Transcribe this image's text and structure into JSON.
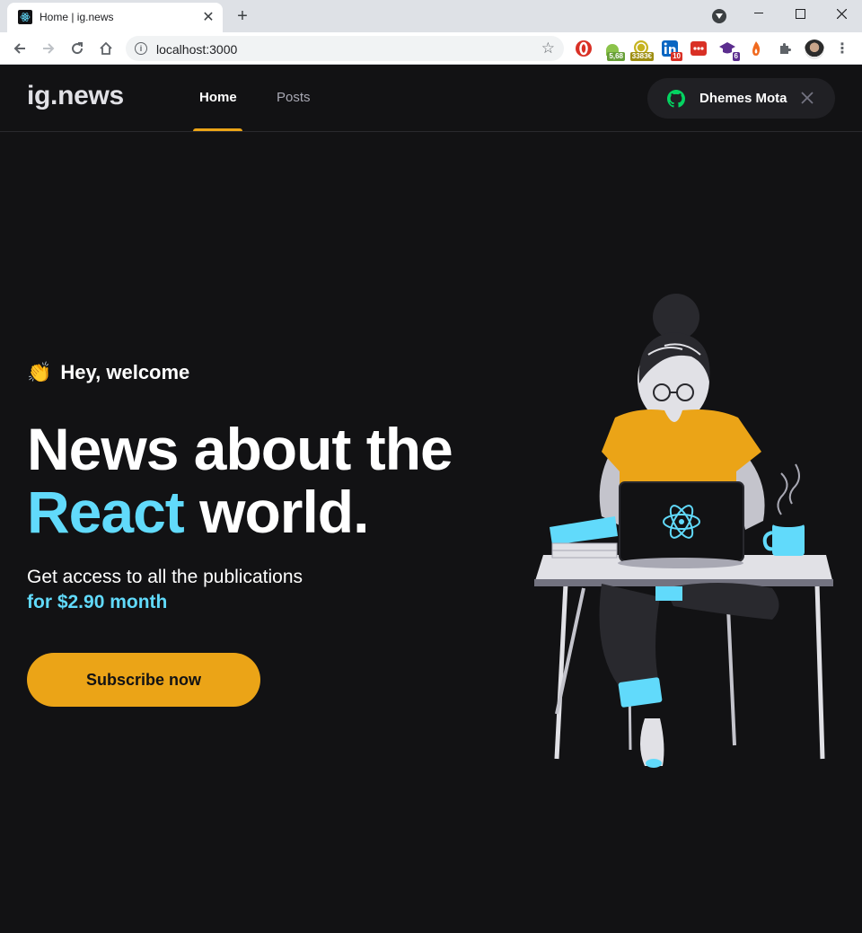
{
  "browser": {
    "tab_title": "Home | ig.news",
    "url": "localhost:3000",
    "extensions": [
      {
        "name": "opera-adblock-icon",
        "color": "#d93025",
        "badge": ""
      },
      {
        "name": "android-ext-icon",
        "color": "#8bc34a",
        "badge": "5,68"
      },
      {
        "name": "coin-ext-icon",
        "color": "#c6b31f",
        "badge": "3383€"
      },
      {
        "name": "linkedin-ext-icon",
        "color": "#0a66c2",
        "badge": "10"
      },
      {
        "name": "red-dots-ext-icon",
        "color": "#d93025",
        "badge": ""
      },
      {
        "name": "graduation-ext-icon",
        "color": "#5b2d8e",
        "badge": "6"
      },
      {
        "name": "flame-ext-icon",
        "color": "#f06a1f",
        "badge": ""
      }
    ]
  },
  "header": {
    "logo": "ig.news",
    "nav": [
      {
        "label": "Home",
        "active": true
      },
      {
        "label": "Posts",
        "active": false
      }
    ],
    "signin": {
      "name": "Dhemes Mota"
    }
  },
  "hero": {
    "greeting": "Hey, welcome",
    "greeting_emoji": "👏",
    "title_line1": "News about the",
    "title_accent": "React",
    "title_line2_rest": "world.",
    "subtitle": "Get access to all the publications",
    "price": "for $2.90 month",
    "cta": "Subscribe now"
  },
  "colors": {
    "background": "#121214",
    "accent_yellow": "#eba417",
    "accent_cyan": "#61dafb",
    "surface": "#202024"
  }
}
